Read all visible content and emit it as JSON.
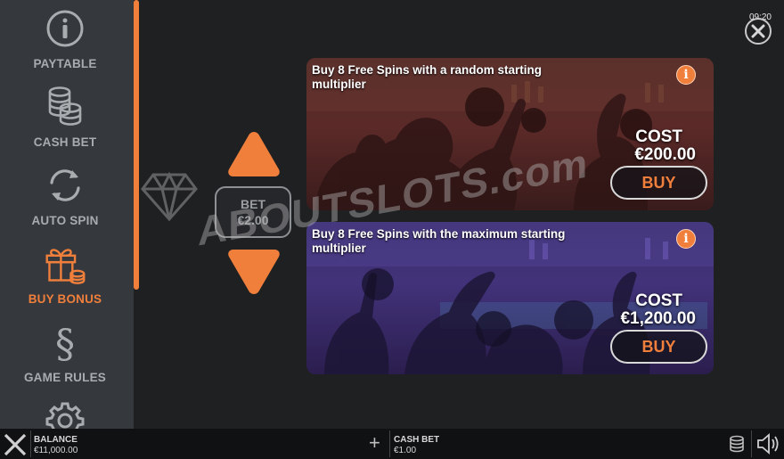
{
  "menu": {
    "items": [
      {
        "label": "PAYTABLE",
        "icon": "info-icon",
        "active": false
      },
      {
        "label": "CASH BET",
        "icon": "coin-stack-icon",
        "active": false
      },
      {
        "label": "AUTO SPIN",
        "icon": "refresh-icon",
        "active": false
      },
      {
        "label": "BUY BONUS",
        "icon": "gift-icon",
        "active": true
      },
      {
        "label": "GAME RULES",
        "icon": "section-icon",
        "active": false
      },
      {
        "label": "",
        "icon": "gear-icon",
        "active": false
      }
    ]
  },
  "clock": "09:20",
  "bet": {
    "label": "BET",
    "value": "€2.00"
  },
  "offers": [
    {
      "title": "Buy 8 Free Spins with a random starting multiplier",
      "cost_label": "COST",
      "cost_value": "€200.00",
      "buy_label": "BUY"
    },
    {
      "title": "Buy 8 Free Spins with the maximum starting multiplier",
      "cost_label": "COST",
      "cost_value": "€1,200.00",
      "buy_label": "BUY"
    }
  ],
  "watermark": {
    "text": "ABOUTSLOTS.com"
  },
  "bottom": {
    "balance_label": "BALANCE",
    "balance_value": "€11,000.00",
    "cashbet_label": "CASH BET",
    "cashbet_value": "€1.00"
  },
  "colors": {
    "accent": "#f07f3c",
    "sidebar": "#35383c",
    "background": "#1f2022",
    "muted_text": "#a9acaf"
  }
}
